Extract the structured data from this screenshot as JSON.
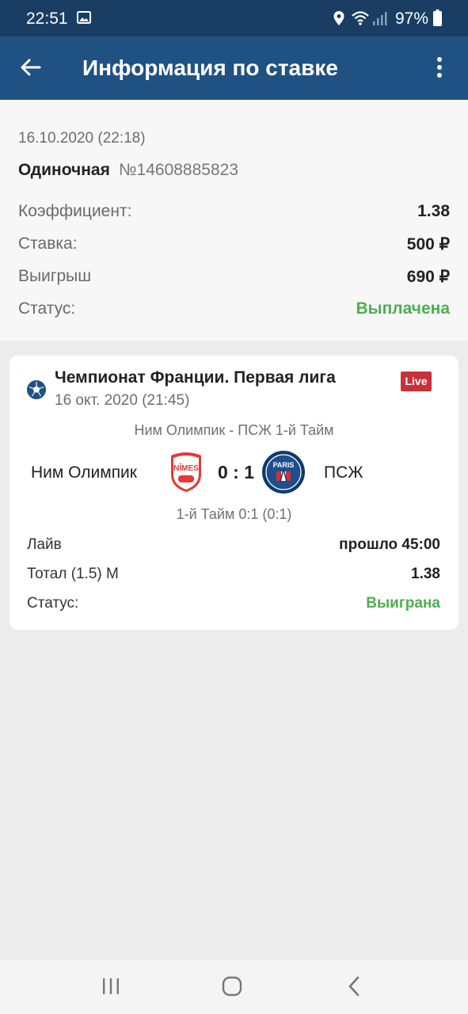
{
  "status_bar": {
    "time": "22:51",
    "battery": "97%",
    "icons": [
      "image-icon",
      "location-icon",
      "wifi-icon",
      "signal-icon",
      "battery-icon"
    ]
  },
  "app_bar": {
    "title": "Информация по ставке",
    "icons": [
      "back-arrow-icon",
      "more-vertical-icon"
    ]
  },
  "summary": {
    "date": "16.10.2020 (22:18)",
    "type": "Одиночная",
    "number": "№14608885823",
    "rows": [
      {
        "label": "Коэффициент:",
        "value": "1.38"
      },
      {
        "label": "Ставка:",
        "value": "500 ₽"
      },
      {
        "label": "Выигрыш",
        "value": "690 ₽"
      },
      {
        "label": "Статус:",
        "value": "Выплачена"
      }
    ]
  },
  "event": {
    "league": "Чемпионат Франции. Первая лига",
    "date": "16 окт. 2020 (21:45)",
    "live_badge": "Live",
    "match_title": "Ним Олимпик - ПСЖ 1-й Тайм",
    "home_team": "Ним Олимпик",
    "away_team": "ПСЖ",
    "score": "0 : 1",
    "half_score": "1-й Тайм 0:1 (0:1)",
    "rows": [
      {
        "label": "Лайв",
        "value": "прошло 45:00"
      },
      {
        "label": "Тотал (1.5) М",
        "value": "1.38"
      },
      {
        "label": "Статус:",
        "value": "Выиграна"
      }
    ],
    "logos": {
      "home": "NÎMES",
      "away": "PARIS"
    }
  },
  "colors": {
    "status_bar": "#1a3e63",
    "app_bar": "#1f5283",
    "success": "#4caf50",
    "live": "#c7313a"
  }
}
